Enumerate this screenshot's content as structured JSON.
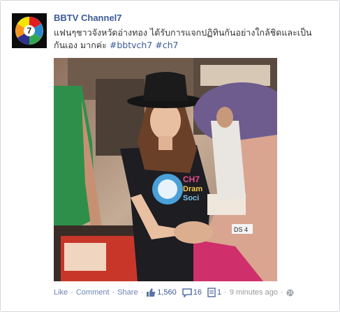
{
  "post": {
    "page_name": "BBTV Channel7",
    "text": "แฟนๆชาวจังหวัดอ่างทอง ได้รับการแจกปฏิทินกันอย่างใกล้ชิดและเป็นกันเอง มากค่ะ",
    "hashtags": [
      "#bbtvch7",
      "#ch7"
    ],
    "shirt_text": [
      "CH7",
      "Dram",
      "Soci"
    ],
    "plate_text": "DS 4"
  },
  "actions": {
    "like": "Like",
    "comment": "Comment",
    "share": "Share",
    "separator": "·"
  },
  "stats": {
    "likes": "1,560",
    "comments": "16",
    "shares": "1",
    "time": "9 minutes ago"
  },
  "icons": {
    "likes": "thumbs-up-icon",
    "comments": "comment-bubble-icon",
    "shares": "share-icon",
    "privacy": "globe-icon",
    "logo": "channel7-logo-icon"
  },
  "colors": {
    "link": "#3b5998",
    "footer_link": "#6d84b4",
    "meta": "#999999"
  }
}
